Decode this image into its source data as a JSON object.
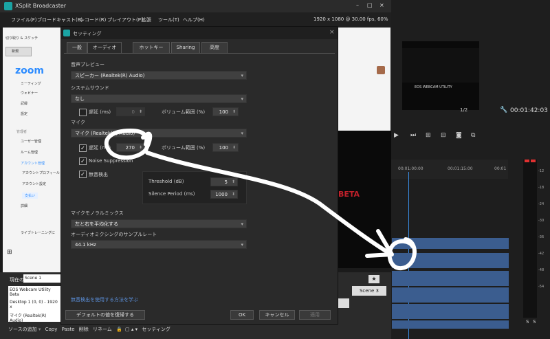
{
  "app": {
    "title": "XSplit Broadcaster",
    "resolution": "1920 x 1080 @ 30.00 fps, 60%",
    "menu": [
      "ファイル(F)",
      "ブロードキャスト(B)",
      "レコード(R)",
      "プレイアウト(P)",
      "拡張",
      "ツール(T)",
      "ヘルプ(H)"
    ],
    "window_controls": [
      "–",
      "□",
      "×"
    ]
  },
  "background_app": {
    "toolbar_text": "切り取り & スケッチ",
    "new_button": "新規",
    "logo": "zoom",
    "sidebar": [
      "ミーティング",
      "ウェビナー",
      "記録",
      "設定",
      "管理者",
      "ユーザー管理",
      "ルーム管理",
      "アカウント管理",
      "アカウントプロフィール",
      "アカウント設定",
      "支払い",
      "詳細"
    ],
    "footer": "ライブトレーニングに"
  },
  "dialog": {
    "title": "セッティング",
    "tabs": [
      "一般",
      "オーディオ",
      "ホットキー",
      "Sharing",
      "高度"
    ],
    "active_tab": "オーディオ",
    "audio_preview_label": "音声プレビュー",
    "audio_preview_value": "スピーカー (Realtek(R) Audio)",
    "system_sound_label": "システムサウンド",
    "system_sound_value": "なし",
    "sys_delay_label": "遅延 (ms)",
    "sys_delay_value": "0",
    "sys_volume_label": "ボリューム範囲 (%)",
    "sys_volume_value": "100",
    "mic_label": "マイク",
    "mic_value": "マイク (Realtek(R) Audio)",
    "mic_delay_label": "遅延 (ms)",
    "mic_delay_value": "270",
    "mic_volume_label": "ボリューム範囲 (%)",
    "mic_volume_value": "100",
    "noise_suppression_label": "Noise Suppression",
    "silence_label": "無音検出",
    "threshold_label": "Threshold (dB)",
    "threshold_value": "5",
    "silence_period_label": "Silence Period (ms)",
    "silence_period_value": "1000",
    "mono_mix_label": "マイクモノラルミックス",
    "mono_mix_value": "左と右を平均化する",
    "sample_rate_label": "オーディオミクシングのサンプルレート",
    "sample_rate_value": "44.1 kHz",
    "learn_link": "無音検出を使用する方法を学ぶ",
    "restore_button": "デフォルトの値を復帰する",
    "ok_button": "OK",
    "cancel_button": "キャンセル",
    "apply_button": "適用"
  },
  "xsplit_lower": {
    "current_label": "現在の",
    "scene_value": "Scene 1",
    "sources": [
      "EOS Webcam Utility Beta",
      "Desktop 1 (0, 0) - 1920 x",
      "マイク (Realtek(R) Audio)"
    ],
    "bottom_bar": [
      "ソースの追加",
      "Copy",
      "Paste",
      "削除",
      "リネーム",
      "セッティング"
    ],
    "scene_button": "Scene 3",
    "scene_button2": "2"
  },
  "editor": {
    "preview_text": "EOS WEBCAM UTILITY",
    "beta_text": "BETA",
    "page_indicator": "1/2",
    "timecode": "00:01:42:03",
    "ruler": [
      "00:01:00:00",
      "00:01:15:00",
      "00:01"
    ],
    "meter_labels": [
      "-12",
      "-18",
      "-24",
      "-30",
      "-36",
      "-42",
      "-48",
      "-54"
    ],
    "solo": "S"
  },
  "annotation_color": "#ffffff"
}
